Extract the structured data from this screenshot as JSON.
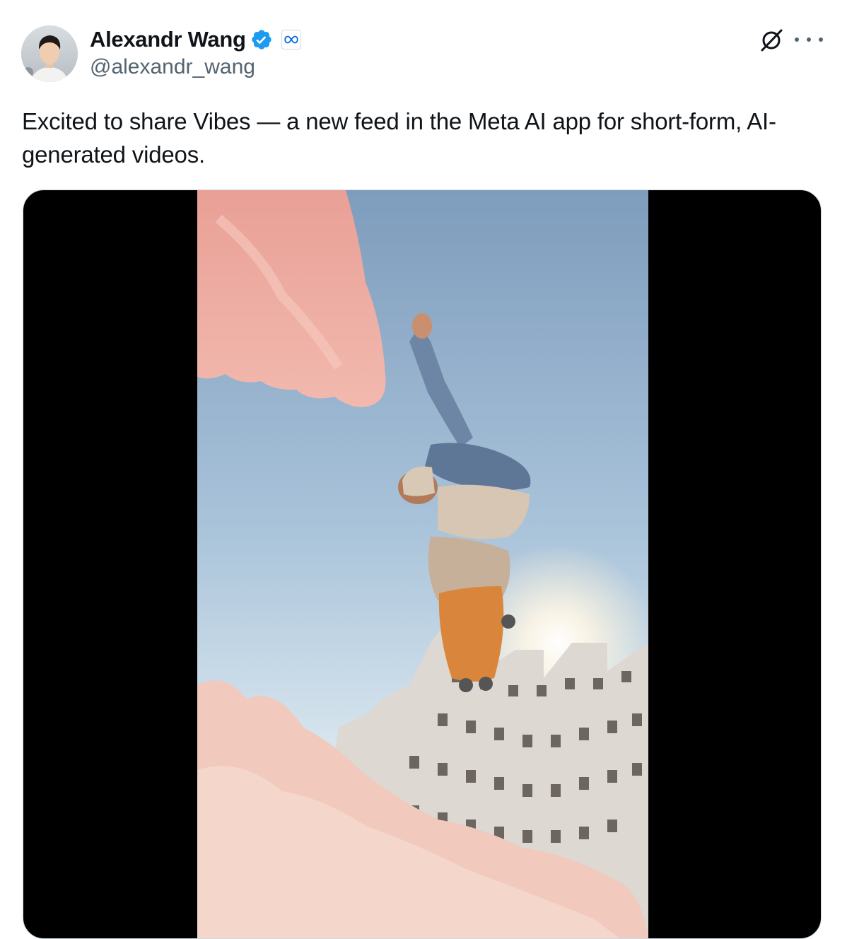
{
  "author": {
    "display_name": "Alexandr Wang",
    "handle": "@alexandr_wang",
    "verified": true,
    "affiliate_badge_icon": "meta-infinity-icon"
  },
  "header_actions": {
    "grok_icon": "grok-icon",
    "more_icon": "more-icon"
  },
  "tweet": {
    "text": "Excited to share Vibes — a new feed in the Meta AI app for short-form, AI-generated videos."
  },
  "media": {
    "type": "video",
    "thumbnail_subject": "skateboarder-upside-down-sky-pink-smoke"
  },
  "colors": {
    "verified_blue": "#1d9bf0",
    "meta_blue": "#0668e1",
    "text_primary": "#0f1419",
    "text_secondary": "#536471"
  }
}
